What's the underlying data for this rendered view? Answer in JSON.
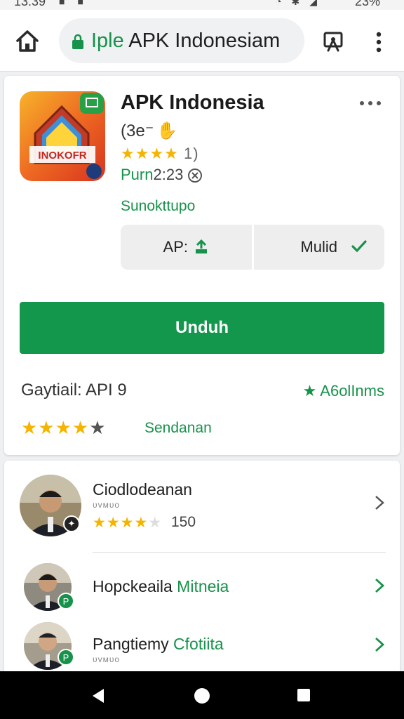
{
  "status_bar": {
    "time": "13:39",
    "battery": "23%"
  },
  "toolbar": {
    "url_prefix": "Iple",
    "url_rest": " APK Indonesiam"
  },
  "app": {
    "title": "APK Indonesia",
    "subtitle": "(3e⁻",
    "rating_stars": "★★★★",
    "rating_count": "1)",
    "version_label": "Purn",
    "version_value": "2:23",
    "category": "Sunokttupo",
    "icon_text": "INOKOFR",
    "segment_left": "AP:",
    "segment_right": "Mulid",
    "download_label": "Unduh",
    "requirements": "Gaytiail: API",
    "requirements_value": "9",
    "badge": "A6olInms",
    "bottom_stars": "★★★★",
    "similar_link": "Sendanan"
  },
  "reviews": [
    {
      "name": "Ciodlodeanan",
      "scribble": "ᴜᴠᴍᴜᴏ",
      "stars": "★★★★",
      "dim": "★",
      "count": "150"
    },
    {
      "name": "Hopckeaila",
      "name_green": " Mitneia"
    },
    {
      "name": "Pangtiemy",
      "name_green": " Cfotiita",
      "scribble": "ᴜᴠᴍᴜᴏ"
    }
  ],
  "colors": {
    "accent": "#13974d",
    "star": "#f4b400"
  },
  "icons": [
    "home-icon",
    "lock-icon",
    "bookmark-icon",
    "more-vert-icon",
    "more-horiz-icon",
    "download-icon",
    "check-icon",
    "star-icon",
    "chevron-right-icon",
    "back-icon",
    "home-nav-icon",
    "recents-icon"
  ]
}
